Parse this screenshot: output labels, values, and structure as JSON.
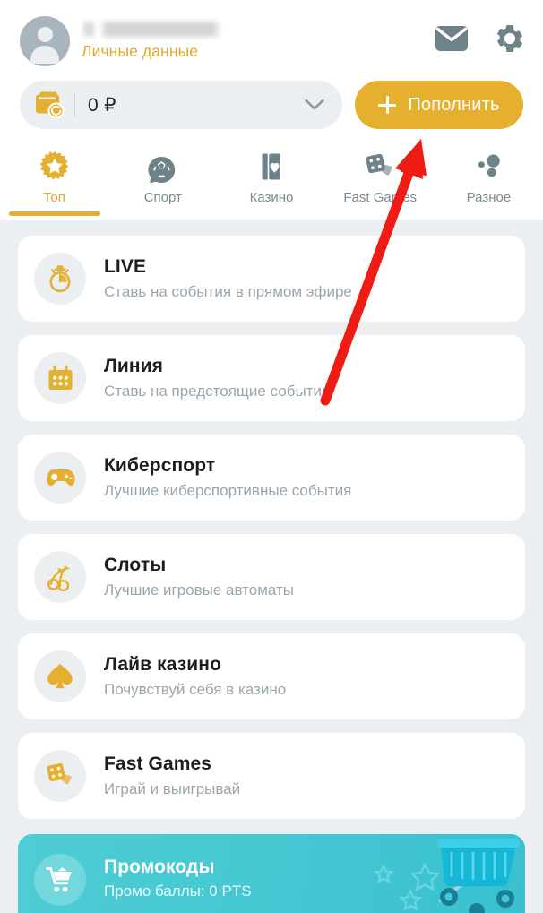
{
  "header": {
    "username_redacted": "",
    "personal_data_label": "Личные данные",
    "mail_icon": "envelope-icon",
    "settings_icon": "gear-icon"
  },
  "balance": {
    "wallet_icon": "wallet-refresh-icon",
    "amount": "0 ₽",
    "chevron_icon": "chevron-down-icon",
    "deposit_label": "Пополнить",
    "deposit_plus_icon": "plus-icon"
  },
  "tabs": [
    {
      "label": "Топ",
      "icon": "star-burst-icon",
      "active": true
    },
    {
      "label": "Спорт",
      "icon": "soccer-ball-icon",
      "active": false
    },
    {
      "label": "Казино",
      "icon": "playing-cards-icon",
      "active": false
    },
    {
      "label": "Fast Games",
      "icon": "dice-icon",
      "active": false
    },
    {
      "label": "Разное",
      "icon": "dots-cluster-icon",
      "active": false
    }
  ],
  "list": [
    {
      "title": "LIVE",
      "subtitle": "Ставь на события в прямом эфире",
      "icon": "stopwatch-icon"
    },
    {
      "title": "Линия",
      "subtitle": "Ставь на предстоящие события",
      "icon": "calendar-icon"
    },
    {
      "title": "Киберспорт",
      "subtitle": "Лучшие киберспортивные события",
      "icon": "gamepad-icon"
    },
    {
      "title": "Слоты",
      "subtitle": "Лучшие игровые автоматы",
      "icon": "cherries-icon"
    },
    {
      "title": "Лайв казино",
      "subtitle": "Почувствуй себя в казино",
      "icon": "spade-icon"
    },
    {
      "title": "Fast Games",
      "subtitle": "Играй и выигрывай",
      "icon": "dice-cards-icon"
    }
  ],
  "promo": {
    "title": "Промокоды",
    "subtitle": "Промо баллы: 0 PTS",
    "icon": "shopping-cart-icon",
    "art": "shopping-basket-art"
  },
  "annotation": {
    "arrow": "red-arrow-pointing-to-deposit-button"
  },
  "colors": {
    "accent": "#e5b02f",
    "accent_text": "#e0a82e",
    "page_bg": "#eceff1",
    "card_bg": "#ffffff",
    "muted_text": "#9aa6ad",
    "tab_inactive": "#7b8a92",
    "promo_teal": "#45c8d2",
    "arrow_red": "#ee1c15"
  }
}
